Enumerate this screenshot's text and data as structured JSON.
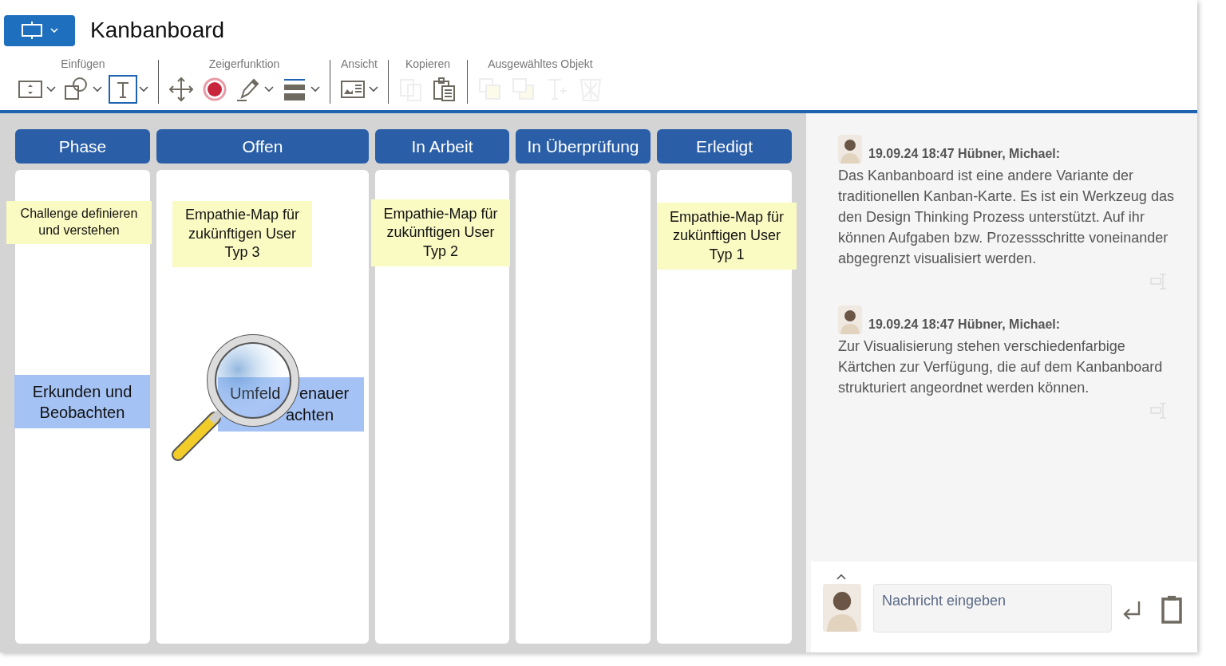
{
  "app_button": {
    "dropdown": true
  },
  "title": "Kanbanboard",
  "toolbar": [
    {
      "label": "Einfügen",
      "tools": [
        {
          "dropdown": true,
          "disabled": false,
          "selected": false
        },
        {
          "dropdown": true,
          "disabled": false,
          "selected": false
        },
        {
          "dropdown": true,
          "disabled": false,
          "selected": true
        }
      ]
    },
    {
      "label": "Zeigerfunktion",
      "tools": [
        {
          "dropdown": false,
          "disabled": false,
          "selected": false
        },
        {
          "dropdown": false,
          "disabled": false,
          "selected": false
        },
        {
          "dropdown": true,
          "disabled": false,
          "selected": false
        },
        {
          "dropdown": true,
          "disabled": false,
          "selected": false
        }
      ]
    },
    {
      "label": "Ansicht",
      "tools": [
        {
          "dropdown": true,
          "disabled": false,
          "selected": false
        }
      ]
    },
    {
      "label": "Kopieren",
      "tools": [
        {
          "dropdown": false,
          "disabled": true,
          "selected": false
        },
        {
          "dropdown": false,
          "disabled": false,
          "selected": false
        }
      ]
    },
    {
      "label": "Ausgewähltes Objekt",
      "tools": [
        {
          "dropdown": false,
          "disabled": true,
          "selected": false
        },
        {
          "dropdown": false,
          "disabled": true,
          "selected": false
        },
        {
          "dropdown": false,
          "disabled": true,
          "selected": false
        },
        {
          "dropdown": false,
          "disabled": true,
          "selected": false
        }
      ]
    }
  ],
  "board": {
    "columns": [
      {
        "title": "Phase",
        "cards": [
          {
            "text": "Challenge definieren und verstehen",
            "color": "#fafac3"
          },
          {
            "text": "Erkunden und Beobachten",
            "color": "#a4c2f4"
          }
        ]
      },
      {
        "title": "Offen",
        "cards": [
          {
            "text": "Empathie-Map für zukünftigen User Typ 3",
            "color": "#fafac3"
          },
          {
            "text_parts": [
              "Umfeld",
              "enauer",
              "achten"
            ],
            "color": "#a4c2f4"
          }
        ]
      },
      {
        "title": "In Arbeit",
        "cards": [
          {
            "text": "Empathie-Map für zukünftigen User Typ 2",
            "color": "#fafac3"
          }
        ]
      },
      {
        "title": "In Überprüfung"
      },
      {
        "title": "Erledigt",
        "cards": [
          {
            "text": "Empathie-Map für zukünftigen User Typ 1",
            "color": "#fafac3"
          }
        ]
      }
    ]
  },
  "chat": {
    "messages": [
      {
        "meta": "19.09.24 18:47 Hübner, Michael:",
        "text": "Das Kanbanboard ist eine andere Variante der traditionellen Kanban-Karte. Es ist ein Werkzeug das den Design Thinking Prozess unterstützt. Auf ihr können Aufgaben bzw. Prozessschritte voneinander abgegrenzt visualisiert werden."
      },
      {
        "meta": "19.09.24 18:47 Hübner, Michael:",
        "text": "Zur Visualisierung stehen verschiedenfarbige Kärtchen zur Verfügung, die auf dem Kanbanboard strukturiert angeordnet werden können."
      }
    ],
    "input": {
      "placeholder": "Nachricht eingeben"
    }
  }
}
